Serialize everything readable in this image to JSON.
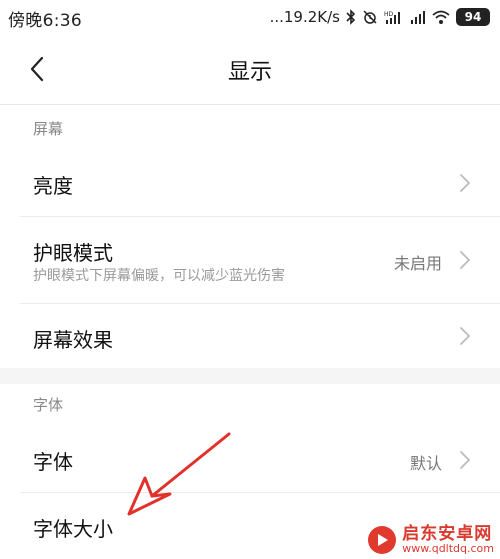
{
  "status_bar": {
    "time": "傍晚6:36",
    "network_speed": "...19.2K/s",
    "battery": "94",
    "icons": [
      "bluetooth-icon",
      "mute-alarm-icon",
      "hd-signal-icon",
      "signal-icon",
      "wifi-icon",
      "battery-icon"
    ]
  },
  "header": {
    "title": "显示",
    "back_icon": "chevron-left-icon"
  },
  "sections": [
    {
      "label": "屏幕",
      "rows": [
        {
          "title": "亮度",
          "subtitle": "",
          "value": ""
        },
        {
          "title": "护眼模式",
          "subtitle": "护眼模式下屏幕偏暖，可以减少蓝光伤害",
          "value": "未启用"
        },
        {
          "title": "屏幕效果",
          "subtitle": "",
          "value": ""
        }
      ]
    },
    {
      "label": "字体",
      "rows": [
        {
          "title": "字体",
          "subtitle": "",
          "value": "默认"
        },
        {
          "title": "字体大小",
          "subtitle": "",
          "value": ""
        }
      ]
    }
  ],
  "watermark": {
    "name": "启东安卓网",
    "url": "www.qdltdq.com"
  },
  "colors": {
    "annotation_arrow": "#e0322b",
    "watermark": "#d93a2e",
    "section_gap": "#f5f5f5"
  }
}
